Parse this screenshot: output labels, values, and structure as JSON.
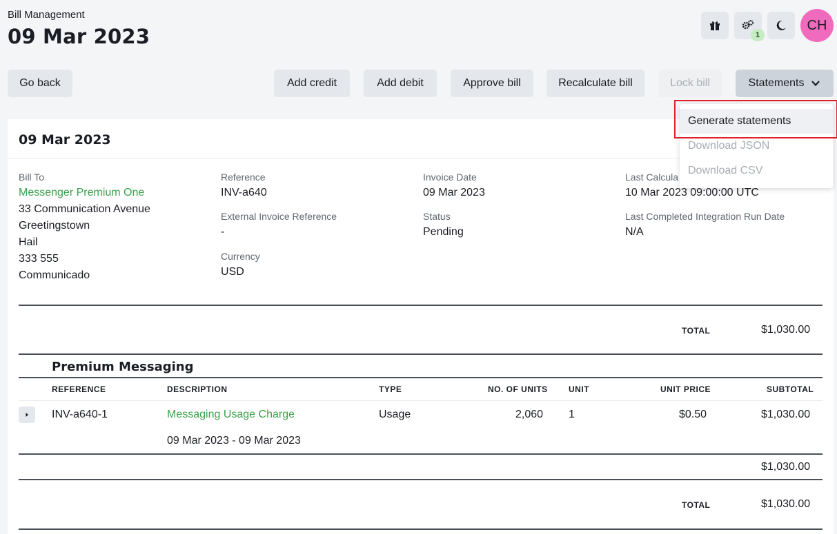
{
  "header": {
    "subtitle": "Bill Management",
    "title": "09 Mar 2023",
    "avatar_initials": "CH",
    "notification_count": "1"
  },
  "actions": {
    "go_back": "Go back",
    "add_credit": "Add credit",
    "add_debit": "Add debit",
    "approve_bill": "Approve bill",
    "recalculate_bill": "Recalculate bill",
    "lock_bill": "Lock bill",
    "statements": "Statements"
  },
  "dropdown": {
    "items": [
      "Generate statements",
      "Download JSON",
      "Download CSV"
    ]
  },
  "bill": {
    "card_title": "09 Mar 2023",
    "bill_to_label": "Bill To",
    "bill_to_name": "Messenger Premium One",
    "address": [
      "33 Communication Avenue",
      "Greetingstown",
      "Hail",
      "333 555",
      "Communicado"
    ],
    "reference_label": "Reference",
    "reference": "INV-a640",
    "ext_ref_label": "External Invoice Reference",
    "ext_ref": "-",
    "currency_label": "Currency",
    "currency": "USD",
    "invoice_date_label": "Invoice Date",
    "invoice_date": "09 Mar 2023",
    "status_label": "Status",
    "status": "Pending",
    "last_calc_label": "Last Calcula",
    "last_calc": "10 Mar 2023 09:00:00 UTC",
    "last_integration_label": "Last Completed Integration Run Date",
    "last_integration": "N/A"
  },
  "totals": {
    "total_label": "TOTAL",
    "total_top": "$1,030.00",
    "section_subtotal": "$1,030.00",
    "total_bottom": "$1,030.00"
  },
  "section": {
    "title": "Premium Messaging",
    "columns": [
      "REFERENCE",
      "DESCRIPTION",
      "TYPE",
      "NO. OF UNITS",
      "UNIT",
      "UNIT PRICE",
      "SUBTOTAL"
    ],
    "row": {
      "reference": "INV-a640-1",
      "description": "Messaging Usage Charge",
      "period": "09 Mar 2023 - 09 Mar 2023",
      "type": "Usage",
      "units": "2,060",
      "unit": "1",
      "unit_price": "$0.50",
      "subtotal": "$1,030.00"
    }
  },
  "colors": {
    "accent_green": "#3aa14a",
    "avatar": "#f06bbd",
    "highlight_red": "#e0202a"
  }
}
